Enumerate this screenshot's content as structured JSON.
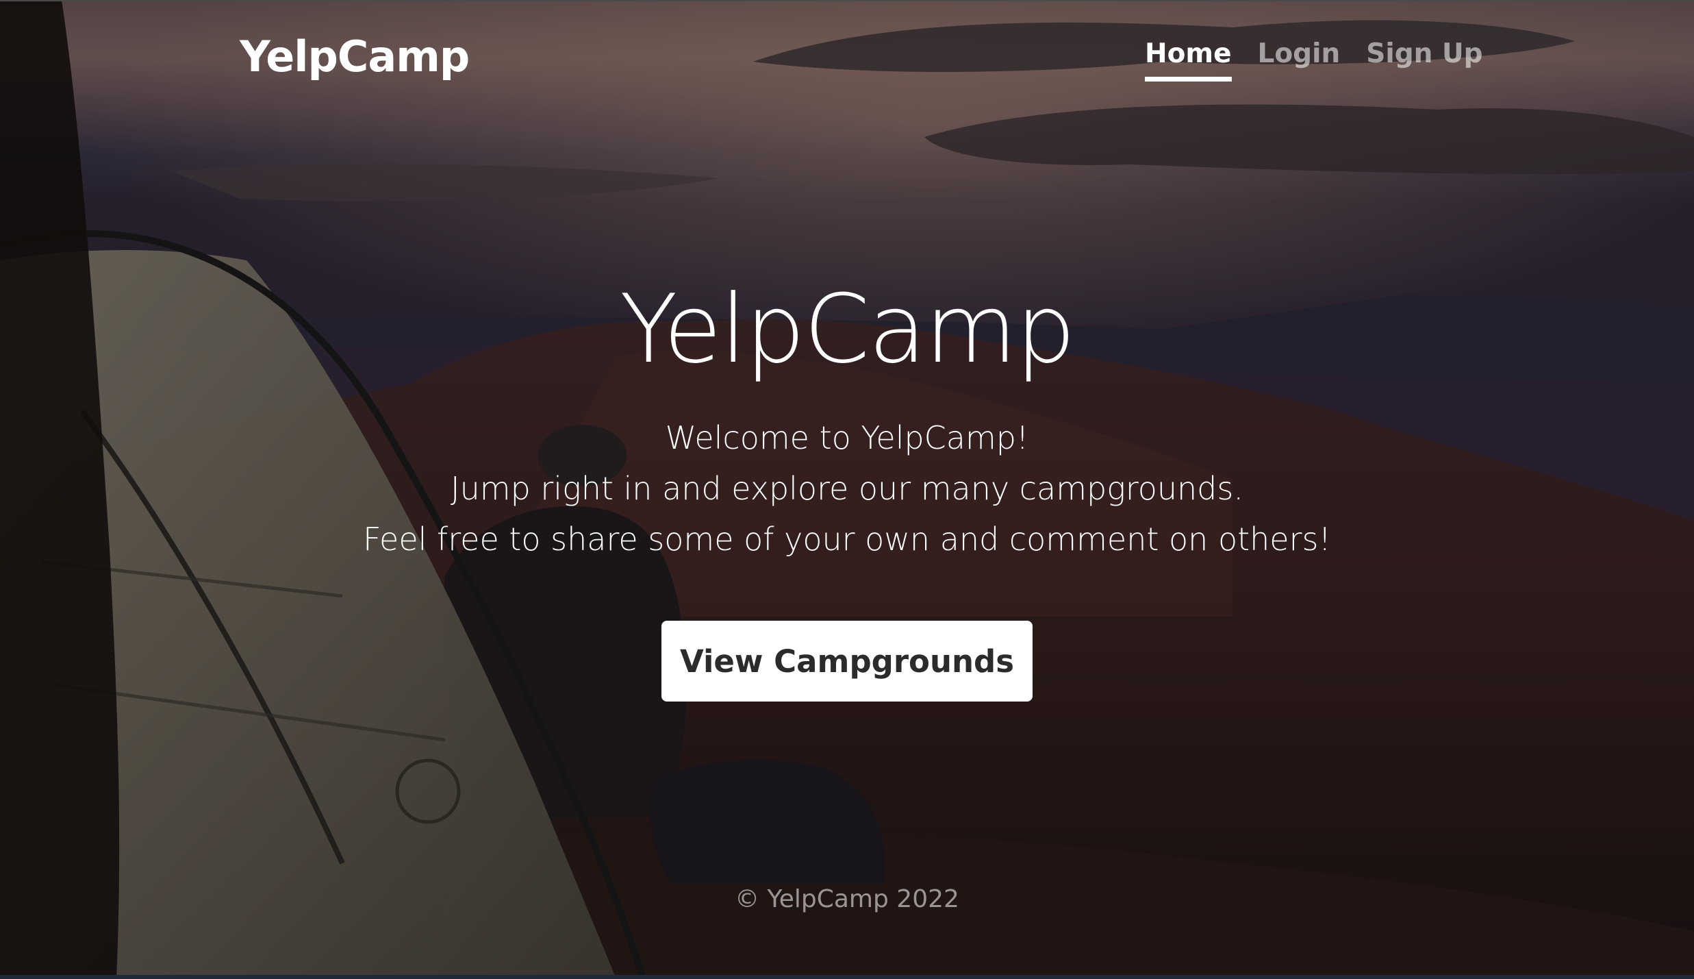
{
  "navbar": {
    "brand": "YelpCamp",
    "links": [
      {
        "label": "Home",
        "active": true
      },
      {
        "label": "Login",
        "active": false
      },
      {
        "label": "Sign Up",
        "active": false
      }
    ]
  },
  "hero": {
    "title": "YelpCamp",
    "lead_lines": [
      "Welcome to YelpCamp!",
      "Jump right in and explore our many campgrounds.",
      "Feel free to share some of your own and comment on others!"
    ],
    "cta_label": "View Campgrounds"
  },
  "footer": {
    "text": "© YelpCamp 2022"
  },
  "colors": {
    "text": "#ffffff",
    "muted_text": "rgba(255,255,255,0.55)",
    "button_bg": "#ffffff",
    "button_text": "#2b2b2b"
  }
}
